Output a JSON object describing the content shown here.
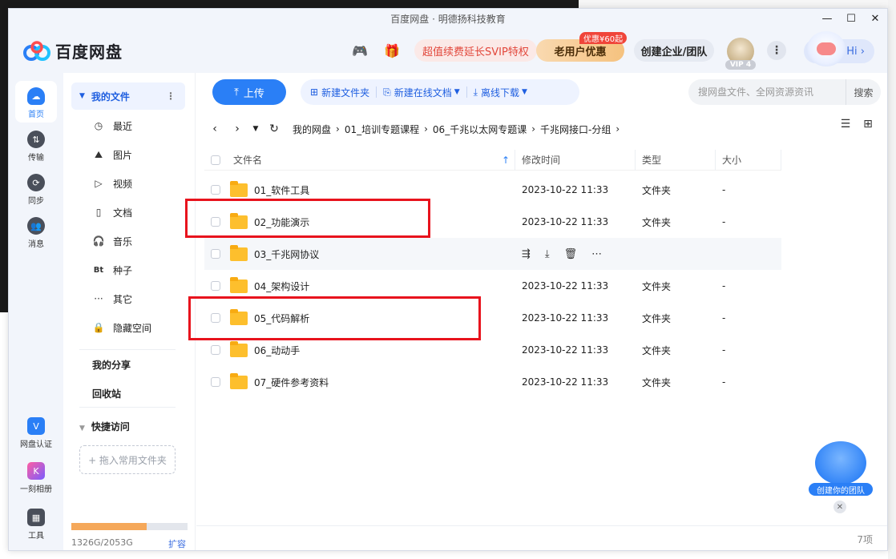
{
  "window": {
    "title": "百度网盘 · 明德扬科技教育"
  },
  "header": {
    "logo_text": "百度网盘",
    "svip_promo": "超值续费延长SVIP特权",
    "old_user_button": "老用户优惠",
    "old_user_tag": "优惠¥60起",
    "enterprise_button": "创建企业/团队",
    "vip_level": "VIP 4",
    "hi_label": "Hi"
  },
  "rail": {
    "items": [
      {
        "label": "首页"
      },
      {
        "label": "传输"
      },
      {
        "label": "同步"
      },
      {
        "label": "消息"
      },
      {
        "label": "网盘认证"
      },
      {
        "label": "一刻相册"
      },
      {
        "label": "工具"
      }
    ]
  },
  "sidebar": {
    "my_files": "我的文件",
    "items": [
      {
        "label": "最近"
      },
      {
        "label": "图片"
      },
      {
        "label": "视频"
      },
      {
        "label": "文档"
      },
      {
        "label": "音乐"
      },
      {
        "label": "种子",
        "icon_text": "Bt"
      },
      {
        "label": "其它"
      },
      {
        "label": "隐藏空间"
      }
    ],
    "my_share": "我的分享",
    "recycle": "回收站",
    "quick_access": "快捷访问",
    "drop_hint": "+ 拖入常用文件夹",
    "quota_text": "1326G/2053G",
    "quota_fraction": 0.646,
    "expand": "扩容"
  },
  "toolbar": {
    "upload": "上传",
    "new_folder": "新建文件夹",
    "new_doc": "新建在线文档",
    "offline": "离线下载",
    "search_placeholder": "搜网盘文件、全网资源资讯",
    "search_button": "搜索"
  },
  "breadcrumb": [
    "我的网盘",
    "01_培训专题课程",
    "06_千兆以太网专题课",
    "千兆网接口-分组"
  ],
  "table": {
    "headers": {
      "name": "文件名",
      "modified": "修改时间",
      "type": "类型",
      "size": "大小"
    },
    "rows": [
      {
        "name": "01_软件工具",
        "modified": "2023-10-22 11:33",
        "type": "文件夹",
        "size": "-"
      },
      {
        "name": "02_功能演示",
        "modified": "2023-10-22 11:33",
        "type": "文件夹",
        "size": "-"
      },
      {
        "name": "03_千兆网协议",
        "modified": "",
        "type": "",
        "size": ""
      },
      {
        "name": "04_架构设计",
        "modified": "2023-10-22 11:33",
        "type": "文件夹",
        "size": "-"
      },
      {
        "name": "05_代码解析",
        "modified": "2023-10-22 11:33",
        "type": "文件夹",
        "size": "-"
      },
      {
        "name": "06_动动手",
        "modified": "2023-10-22 11:33",
        "type": "文件夹",
        "size": "-"
      },
      {
        "name": "07_硬件参考资料",
        "modified": "2023-10-22 11:33",
        "type": "文件夹",
        "size": "-"
      }
    ]
  },
  "status": {
    "count": "7项"
  },
  "team_badge": {
    "label": "创建你的团队"
  }
}
